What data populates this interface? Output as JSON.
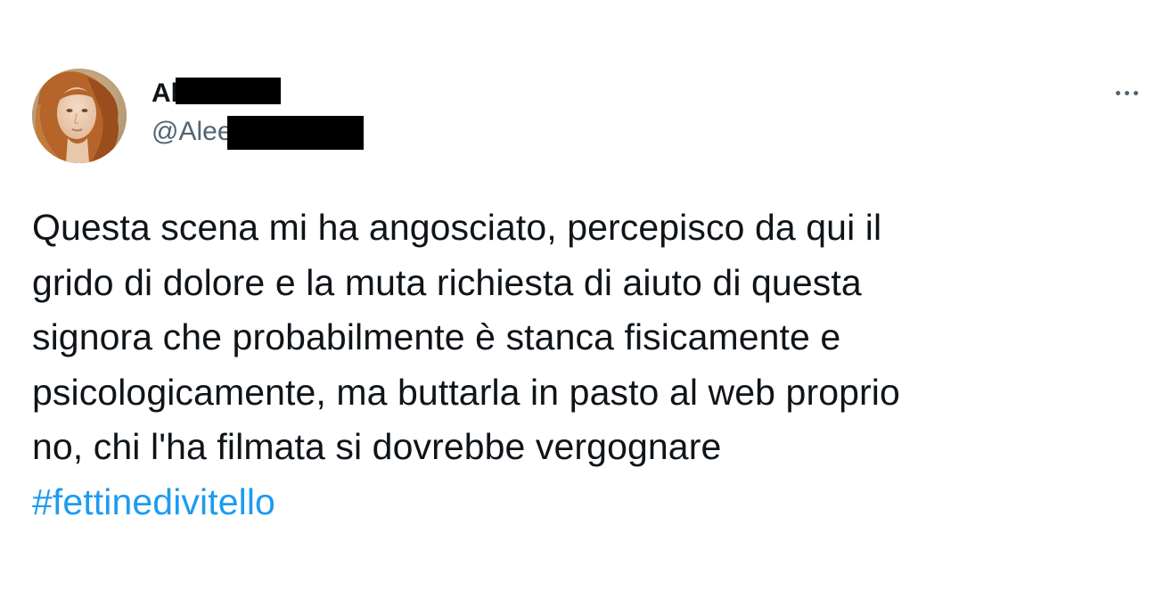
{
  "author": {
    "display_name_visible": "Al",
    "handle_visible": "@Alee"
  },
  "tweet": {
    "lines": [
      "Questa scena mi ha angosciato, percepisco da qui il",
      "grido di dolore e la muta richiesta di aiuto di questa",
      "signora che probabilmente è stanca fisicamente e",
      "psicologicamente, ma buttarla in pasto al web proprio",
      "no, chi l'ha filmata si dovrebbe vergognare"
    ],
    "hashtag": "#fettinedivitello"
  },
  "colors": {
    "text": "#0f1419",
    "secondary": "#536471",
    "link": "#1d9bf0",
    "redaction": "#000000"
  },
  "icons": {
    "more": "more-horizontal-icon"
  }
}
